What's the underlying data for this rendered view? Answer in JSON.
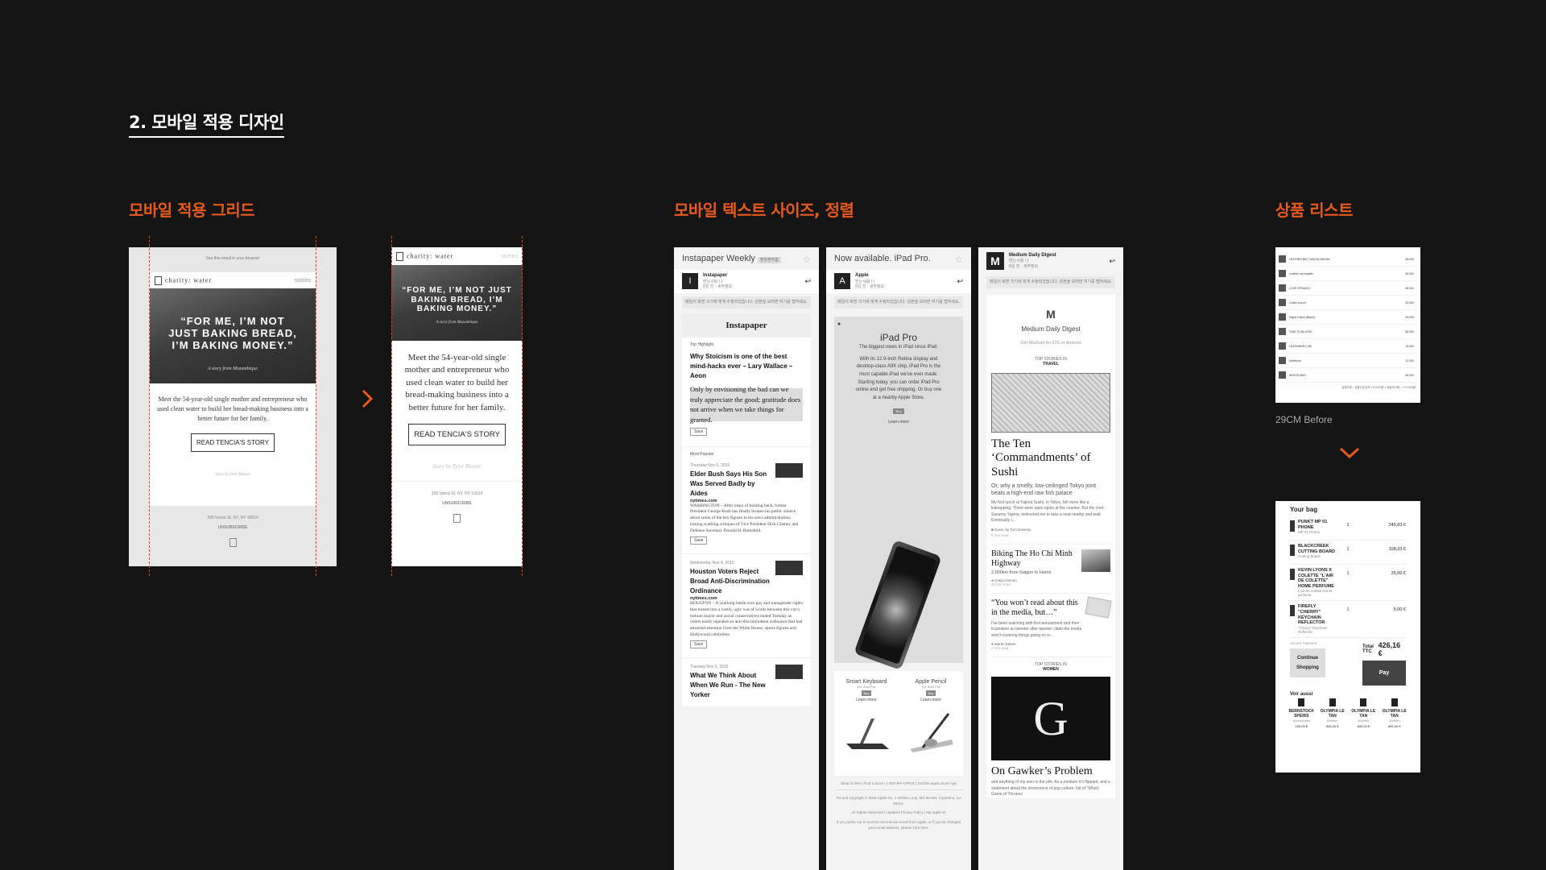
{
  "section_title": "2. 모바일 적용 디자인",
  "subtitles": {
    "grid": "모바일 적용 그리드",
    "text": "모바일 텍스트 사이즈, 정렬",
    "products": "상품 리스트"
  },
  "charity": {
    "topline": "See this email in your browser",
    "brand": "charity: water",
    "stories": "stories",
    "quote": "“FOR ME, I’M NOT JUST BAKING BREAD, I’M BAKING MONEY.”",
    "sub": "A story from Mozambique",
    "body1": "Meet the 54-year-old single mother and entrepreneur who used clean water to build her bread-making business into a better future for her family.",
    "body2": "Meet the 54-year-old single mother and entrepreneur who used clean water to build her bread-making business into a better future for her family.",
    "button": "READ TENCIA'S STORY",
    "byline": "Story by Tyler Riewer",
    "address": "200 Varick St. NY, NY 10014",
    "unsubscribe": "UNSUBSCRIBE"
  },
  "instapaper": {
    "title": "Instapaper Weekly",
    "tag": "받은편지함",
    "sender": "Instapaper",
    "to": "받는사람 나",
    "time": "8일 전 · 세부정보",
    "notice": "메일이 화면 크기에 맞게 수정되었습니다. 원본을 보려면 여기를 탭하세요.",
    "header": "Instapaper",
    "top": "Top Highlight",
    "h1": "Why Stoicism is one of the best mind-hacks ever – Lary Wallace – Aeon",
    "h1_quote": "Only by envisioning the bad can we truly appreciate the good; gratitude does not arrive when we take things for granted.",
    "save": "Save",
    "popular": "Most Popular",
    "d1": "Thursday Nov 5, 2015",
    "a1": "Elder Bush Says His Son Was Served Badly by Aides",
    "src": "nytimes.com",
    "p1": "WASHINGTON – After years of holding back, former President George Bush has finally broken his public silence about some of the key figures in his son's administration, issuing scathing critiques of Vice President Dick Cheney and Defense Secretary Donald H. Rumsfeld.",
    "d2": "Wednesday Nov 4, 2015",
    "a2": "Houston Voters Reject Broad Anti-Discrimination Ordinance",
    "p2": "HOUSTON – A yearlong battle over gay and transgender rights that turned into a costly, ugly war of words between this city's lesbian mayor and social conservatives ended Tuesday as voters easily repealed an anti-discrimination ordinance that had attracted attention from the White House, sports figures and Hollywood celebrities.",
    "d3": "Tuesday Nov 3, 2015",
    "a3": "What We Think About When We Run - The New Yorker"
  },
  "ipad": {
    "title": "Now available. iPad Pro.",
    "sender": "Apple",
    "to": "받는사람 나",
    "time": "8일 전 · 세부정보",
    "notice": "메일이 화면 크기에 맞게 수정되었습니다. 원본을 보려면 여기를 탭하세요.",
    "product": "iPad Pro",
    "tagline": "The biggest news in iPad since iPad.",
    "desc": "With its 12.9-inch Retina display and desktop-class A9X chip, iPad Pro is the most capable iPad we've ever made. Starting today, you can order iPad Pro online and get free shipping. Or buy one at a nearby Apple Store.",
    "buy": "Buy",
    "learn": "Learn more",
    "kb": "Smart Keyboard",
    "kb_sub": "For iPad Pro",
    "pencil": "Apple Pencil",
    "pencil_sub": "For iPad Pro",
    "footer1": "Shop Online  |  Find a Store  |  1-800-MY-APPLE  |  Get the Apple Store App",
    "footer2": "TM and copyright © 2015 Apple Inc. 1 Infinite Loop, MS 96-DM, Cupertino, CA 95014.",
    "footer3": "All Rights Reserved  |  Updated Privacy Policy  |  My Apple ID",
    "footer4": "If you prefer not to receive commercial email from Apple, or if you've changed your email address, please click here."
  },
  "medium": {
    "title": "Medium Daily Digest",
    "to": "받는사람 나",
    "time": "8일 전 · 세부정보",
    "notice": "메일이 화면 크기에 맞게 수정되었습니다. 원본을 보려면 여기를 탭하세요.",
    "digest": "Medium Daily Digest",
    "get": "Get Medium for iOS or Android",
    "top_in": "TOP STORIES IN",
    "travel": "TRAVEL",
    "h1": "The Ten ‘Commandments’ of Sushi",
    "h1_sub": "Or, why a smelly, low-ceilinged Tokyo joint beats a high-end raw fish palace",
    "h1_body": "My first lunch at Yajima Sushi, in Tokyo, felt more like a kidnapping. There were open spots at the counter. But the chef, Susumu Yajima, instructed me to take a seat nearby and wait. Eventually I...",
    "h1_by": "Gone, by Tom Downey",
    "h1_read": "8 min read",
    "h2": "Biking The Ho Chi Minh Highway",
    "h2_sub": "2,000km from Saigon to Hanoi",
    "h2_by": "Craig Cannon",
    "h2_read": "20 min read",
    "h3": "“You won’t read about this in the media, but…”",
    "h3_body": "I've been watching with first amusement and then frustration as tweeter after tweeter claim the media aren't covering things going on in...",
    "h3_by": "Martin Belam",
    "h3_read": "2 min read",
    "women": "WOMEN",
    "h4": "On Gawker’s Problem",
    "h4_body": "and anything of my own to the pile. As a medium it's flippant, and a statement about the irreverence of pop culture, full of “Which Game of Thrones"
  },
  "products": {
    "before": "29CM Before",
    "bag": "Your bag",
    "items": [
      {
        "name": "PUNKT MP 01 PHONE",
        "sub": "MP 01 Phone",
        "qty": "1",
        "price": "245,83 €"
      },
      {
        "name": "BLACKCREEK CUTTING BOARD",
        "sub": "Cutting Board",
        "qty": "1",
        "price": "108,33 €"
      },
      {
        "name": "KEVIN LYONS X COLETTE \"L'AIR DE COLETTE\" HOME PERFUME",
        "sub": "L'air de colette Home perfume",
        "qty": "1",
        "price": "25,00 €"
      },
      {
        "name": "FIREFLY \"CHERRY\" KEYCHAIN REFLECTOR",
        "sub": "\"Cherry\" Keychain Reflector",
        "qty": "1",
        "price": "5,00 €"
      }
    ],
    "secure": "Secure Payment",
    "total_label": "Total TTC",
    "total": "426,16 €",
    "continue": "Continue Shopping",
    "pay": "Pay",
    "voir": "Voir aussi",
    "also": [
      {
        "name": "BERNSTOCK SPEIRS",
        "sub": "Accessories",
        "price": "155,00 €"
      },
      {
        "name": "OLYMPIA LE TAN",
        "sub": "Women",
        "price": "805,00 €"
      },
      {
        "name": "OLYMPIA LE TAN",
        "sub": "Women",
        "price": "805,00 €"
      },
      {
        "name": "OLYMPIA LE TAN",
        "sub": "Women",
        "price": "805,00 €"
      }
    ],
    "before_rows": [
      {
        "name": "LEATHER BELT MACKLEBOOK",
        "price": "35,000"
      },
      {
        "name": "Leather card wallet",
        "price": "35,000"
      },
      {
        "name": "LOVE SPINACH",
        "price": "48,000"
      },
      {
        "name": "Cotton pouch",
        "price": "32,000"
      },
      {
        "name": "Paper Fabric (Black)",
        "price": "39,000"
      },
      {
        "name": "TIME TO BLOOM",
        "price": "55,000"
      },
      {
        "name": "LEASHMENT_BK",
        "price": "19,000"
      },
      {
        "name": "Notebook",
        "price": "12,000"
      },
      {
        "name": "WHITELAND",
        "price": "45,000"
      }
    ],
    "before_total": "상품주문 : 상품주문금액 170,000원 + 배송비 0원 = 170,000원"
  },
  "colors": {
    "accent": "#e85a1c",
    "background": "#141414"
  }
}
